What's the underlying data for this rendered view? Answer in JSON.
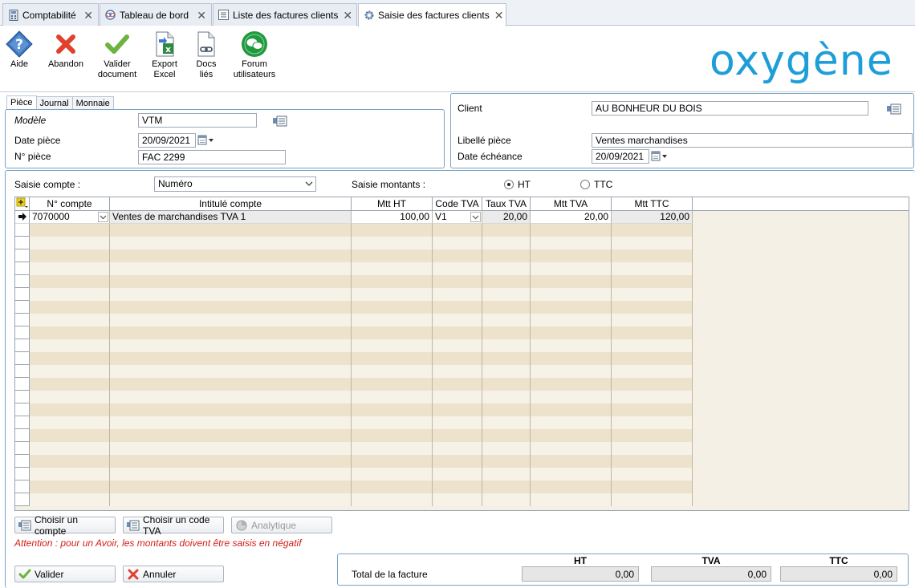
{
  "tabs": [
    {
      "label": "Comptabilité",
      "icon": "calculator-icon",
      "active": false
    },
    {
      "label": "Tableau de bord",
      "icon": "dashboard-icon",
      "active": false
    },
    {
      "label": "Liste des factures clients",
      "icon": "list-icon",
      "active": false
    },
    {
      "label": "Saisie des factures clients",
      "icon": "gear-icon",
      "active": true
    }
  ],
  "toolbar": {
    "aide": "Aide",
    "abandon": "Abandon",
    "valider_line1": "Valider",
    "valider_line2": "document",
    "export_line1": "Export",
    "export_line2": "Excel",
    "docs_line1": "Docs",
    "docs_line2": "liés",
    "forum_line1": "Forum",
    "forum_line2": "utilisateurs"
  },
  "logo": "oxygène",
  "piece_tabs": [
    "Pièce",
    "Journal",
    "Monnaie"
  ],
  "piece": {
    "modele_label": "Modèle",
    "modele_value": "VTM",
    "date_label": "Date pièce",
    "date_value": "20/09/2021",
    "numero_label": "N° pièce",
    "numero_value": "FAC 2299"
  },
  "client_panel": {
    "client_label": "Client",
    "client_value": "AU BONHEUR DU BOIS",
    "libelle_label": "Libellé pièce",
    "libelle_value": "Ventes marchandises",
    "echeance_label": "Date échéance",
    "echeance_value": "20/09/2021"
  },
  "saisie": {
    "compte_label": "Saisie compte :",
    "compte_value": "Numéro",
    "montants_label": "Saisie montants :",
    "ht_label": "HT",
    "ttc_label": "TTC",
    "selected": "HT"
  },
  "grid": {
    "columns": [
      "N° compte",
      "Intitulé compte",
      "Mtt HT",
      "Code TVA",
      "Taux TVA",
      "Mtt TVA",
      "Mtt TTC"
    ],
    "rows": [
      {
        "compte": "7070000",
        "intitule": "Ventes de marchandises TVA 1",
        "mtt_ht": "100,00",
        "code_tva": "V1",
        "taux_tva": "20,00",
        "mtt_tva": "20,00",
        "mtt_ttc": "120,00"
      }
    ]
  },
  "buttons": {
    "choisir_compte": "Choisir un compte",
    "choisir_tva": "Choisir un code TVA",
    "analytique": "Analytique",
    "valider": "Valider",
    "annuler": "Annuler"
  },
  "warning": "Attention : pour un Avoir, les montants doivent être saisis en négatif",
  "totals": {
    "label": "Total de la facture",
    "ht_header": "HT",
    "tva_header": "TVA",
    "ttc_header": "TTC",
    "ht": "0,00",
    "tva": "0,00",
    "ttc": "0,00"
  },
  "colors": {
    "accent": "#1e9ed8",
    "warning": "#d0201a",
    "row_odd": "#ede2cb",
    "row_even": "#f7f2e8"
  }
}
